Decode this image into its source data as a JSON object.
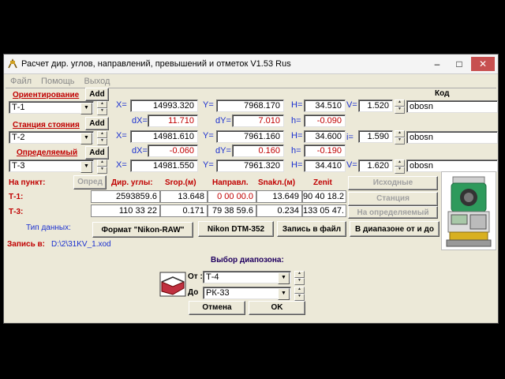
{
  "window": {
    "title": "Расчет дир. углов, направлений, превышений и отметок  V1.53 Rus",
    "controls": [
      "–",
      "□",
      "✕"
    ]
  },
  "menu": [
    "Файл",
    "Помощь",
    "Выход"
  ],
  "rows": [
    {
      "label": "Ориентирование",
      "add": "Add",
      "point": "Т-1",
      "x": "14993.320",
      "y": "7968.170",
      "h": "34.510",
      "v": "1.520",
      "code": "obosn",
      "dx": "11.710",
      "dy": "7.010",
      "dh": "-0.090"
    },
    {
      "label": "Станция стояния",
      "add": "Add",
      "point": "Т-2",
      "x": "14981.610",
      "y": "7961.160",
      "h": "34.600",
      "v": "1.590",
      "code": "obosn",
      "dx": "-0.060",
      "dy": "0.160",
      "dh": "-0.190"
    },
    {
      "label": "Определяемый",
      "add": "Add",
      "point": "Т-3",
      "x": "14981.550",
      "y": "7961.320",
      "h": "34.410",
      "v": "1.620",
      "code": "obosn"
    }
  ],
  "axis": {
    "x": "X=",
    "y": "Y=",
    "h": "H=",
    "v": "V=",
    "i": "i=",
    "dx": "dX=",
    "dy": "dY=",
    "dh": "h="
  },
  "code_header": "Код",
  "table": {
    "na_punkt": "На пункт:",
    "opred": "Опред",
    "headers": [
      "Дир. углы:",
      "Srop.(м)",
      "Направл.",
      "Snakл.(м)",
      "Zenit"
    ],
    "rows": [
      {
        "label": "Т-1:",
        "cells": [
          "2593859.6",
          "13.648",
          "0 00 00.0",
          "13.649",
          "90 40 18.2"
        ]
      },
      {
        "label": "Т-3:",
        "cells": [
          "110 33 22",
          "0.171",
          "79 38 59.6",
          "0.234",
          "133 05 47."
        ]
      }
    ]
  },
  "right_buttons": [
    "Исходные",
    "Станция",
    "На определяемый"
  ],
  "data_type_label": "Тип данных:",
  "bottom_buttons": [
    "Формат \"Nikon-RAW\"",
    "Nikon DTM-352",
    "Запись в файл",
    "В диапазоне от и до"
  ],
  "write_to_label": "Запись в:",
  "write_to_path": "D:\\2\\31KV_1.xod",
  "range": {
    "title": "Выбор диапозона:",
    "from_label": "От :",
    "from_value": "Т-4",
    "to_label": "До",
    "to_value": "РК-33",
    "cancel": "Отмена",
    "ok": "OK"
  }
}
